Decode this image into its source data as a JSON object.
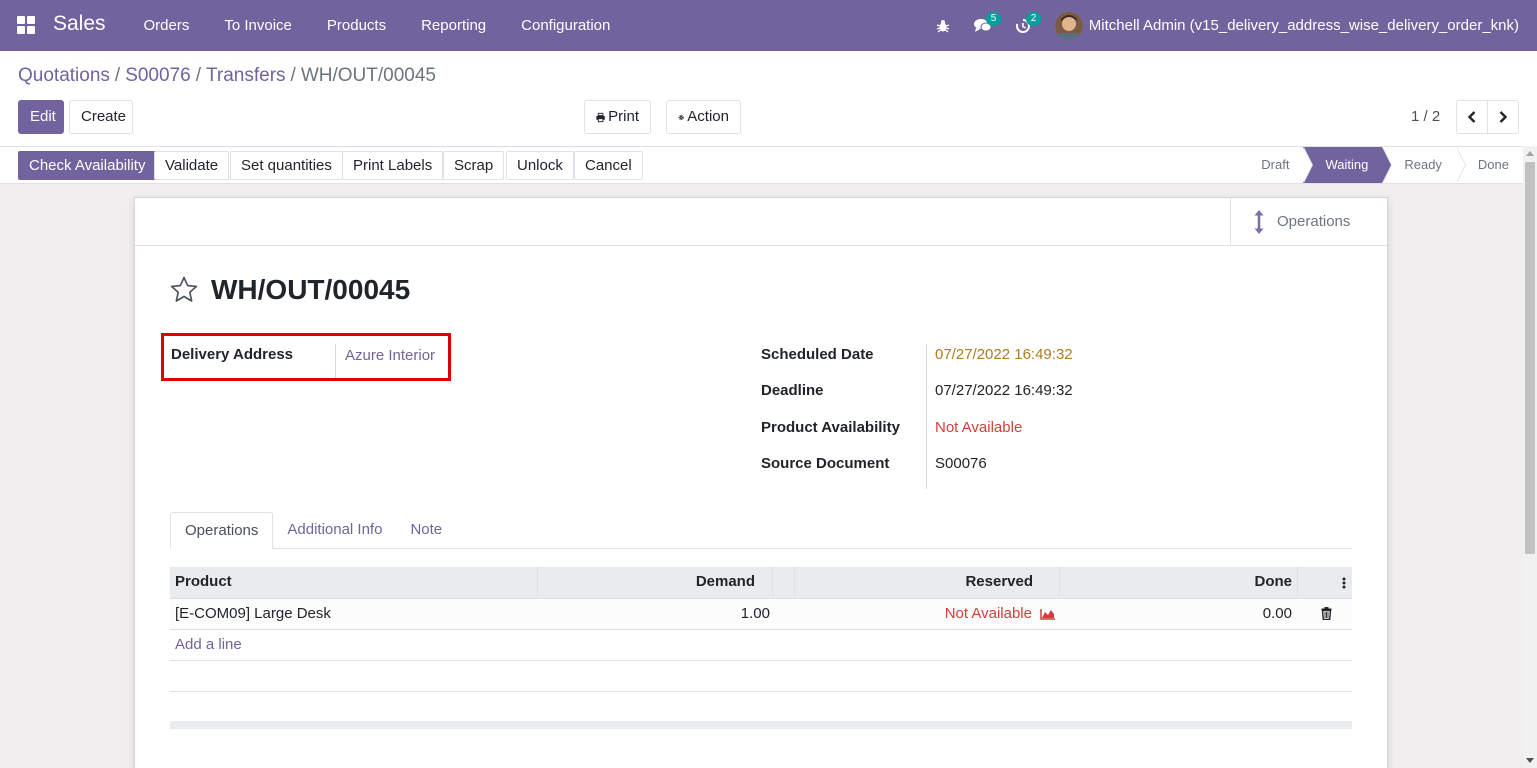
{
  "navbar": {
    "app_name": "Sales",
    "menu": [
      "Orders",
      "To Invoice",
      "Products",
      "Reporting",
      "Configuration"
    ],
    "chat_badge": "5",
    "activity_badge": "2",
    "user_name": "Mitchell Admin (v15_delivery_address_wise_delivery_order_knk)"
  },
  "breadcrumb": {
    "items": [
      "Quotations",
      "S00076",
      "Transfers"
    ],
    "current": "WH/OUT/00045"
  },
  "control": {
    "edit_label": "Edit",
    "create_label": "Create",
    "print_label": "Print",
    "action_label": "Action",
    "pager": "1 / 2"
  },
  "statusbar": {
    "buttons": [
      "Check Availability",
      "Validate",
      "Set quantities",
      "Print Labels",
      "Scrap",
      "Unlock",
      "Cancel"
    ],
    "stages": [
      "Draft",
      "Waiting",
      "Ready",
      "Done"
    ],
    "active_stage": "Waiting"
  },
  "form": {
    "smart_button": "Operations",
    "title": "WH/OUT/00045",
    "delivery_address_label": "Delivery Address",
    "delivery_address_value": "Azure Interior",
    "scheduled_date_label": "Scheduled Date",
    "scheduled_date_value": "07/27/2022 16:49:32",
    "deadline_label": "Deadline",
    "deadline_value": "07/27/2022 16:49:32",
    "availability_label": "Product Availability",
    "availability_value": "Not Available",
    "source_label": "Source Document",
    "source_value": "S00076",
    "tabs": [
      "Operations",
      "Additional Info",
      "Note"
    ],
    "active_tab": "Operations"
  },
  "table": {
    "headers": {
      "product": "Product",
      "demand": "Demand",
      "reserved": "Reserved",
      "done": "Done"
    },
    "rows": [
      {
        "product": "[E-COM09] Large Desk",
        "demand": "1.00",
        "reserved": "Not Available",
        "done": "0.00"
      }
    ],
    "add_line": "Add a line"
  },
  "colors": {
    "brand": "#71639e",
    "warning_date": "#b07a1e",
    "danger": "#d23f3a",
    "highlight": "#e00000"
  }
}
